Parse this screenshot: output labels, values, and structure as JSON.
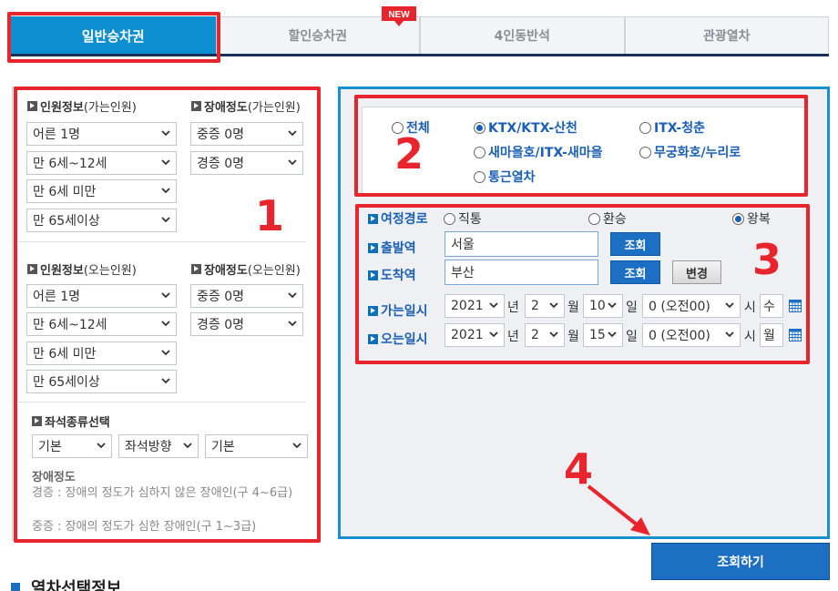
{
  "tabs": [
    {
      "label": "일반승차권",
      "active": true
    },
    {
      "label": "할인승차권",
      "active": false,
      "badge": "NEW"
    },
    {
      "label": "4인동반석",
      "active": false
    },
    {
      "label": "관광열차",
      "active": false
    }
  ],
  "passengers_go": {
    "title": "인원정보",
    "subtitle": "(가는인원)",
    "selects": [
      "어른 1명",
      "만 6세~12세",
      "만 6세 미만",
      "만 65세이상"
    ]
  },
  "disability_go": {
    "title": "장애정도",
    "subtitle": "(가는인원)",
    "selects": [
      "중증 0명",
      "경증 0명"
    ]
  },
  "passengers_return": {
    "title": "인원정보",
    "subtitle": "(오는인원)",
    "selects": [
      "어른 1명",
      "만 6세~12세",
      "만 6세 미만",
      "만 65세이상"
    ]
  },
  "disability_return": {
    "title": "장애정도",
    "subtitle": "(오는인원)",
    "selects": [
      "중증 0명",
      "경증 0명"
    ]
  },
  "seat": {
    "title": "좌석종류선택",
    "selects": [
      "기본",
      "좌석방향",
      "기본"
    ]
  },
  "notes": {
    "title": "장애정도",
    "line1": "경증 : 장애의 정도가 심하지 않은 장애인(구 4~6급)",
    "line2": "중증 : 장애의 정도가 심한 장애인(구 1~3급)"
  },
  "train_types": [
    {
      "label": "전체",
      "checked": false
    },
    {
      "label": "KTX/KTX-산천",
      "checked": true
    },
    {
      "label": "ITX-청춘",
      "checked": false
    },
    {
      "label": "새마을호/ITX-새마을",
      "checked": false
    },
    {
      "label": "무궁화호/누리로",
      "checked": false
    },
    {
      "label": "통근열차",
      "checked": false
    }
  ],
  "route": {
    "label": "여정경로",
    "options": [
      {
        "label": "직통",
        "checked": false
      },
      {
        "label": "환승",
        "checked": false
      },
      {
        "label": "왕복",
        "checked": true
      }
    ]
  },
  "departure": {
    "label": "출발역",
    "value": "서울",
    "lookup": "조회"
  },
  "arrival": {
    "label": "도착역",
    "value": "부산",
    "lookup": "조회",
    "swap": "변경"
  },
  "go_date": {
    "label": "가는일시",
    "year": "2021",
    "month": "2",
    "day": "10",
    "hour": "0 (오전00)",
    "weekday": "수"
  },
  "return_date": {
    "label": "오는일시",
    "year": "2021",
    "month": "2",
    "day": "15",
    "hour": "0 (오전00)",
    "weekday": "월"
  },
  "units": {
    "year": "년",
    "month": "월",
    "day": "일",
    "hour": "시"
  },
  "search_button": "조회하기",
  "bottom_title": "열차선택정보",
  "annotations": [
    "1",
    "2",
    "3",
    "4"
  ],
  "colors": {
    "accent": "#0d8ed1",
    "button": "#1d6fc4",
    "annotation": "#e8242c",
    "nav_border": "#1c2f5a"
  }
}
